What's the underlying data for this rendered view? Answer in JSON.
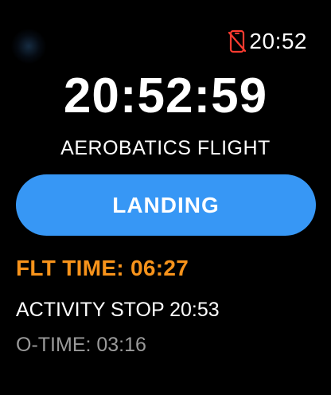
{
  "status_bar": {
    "time": "20:52",
    "disconnected_icon": "phone-disconnected-icon",
    "icon_color": "#ff3b30"
  },
  "main": {
    "clock": "20:52:59",
    "activity_name": "AEROBATICS FLIGHT",
    "landing_button_label": "LANDING",
    "flight_time": "FLT TIME: 06:27",
    "activity_stop": "ACTIVITY STOP 20:53",
    "o_time": "O-TIME: 03:16"
  },
  "colors": {
    "background": "#000000",
    "button": "#3797f5",
    "flight_time": "#f7931b",
    "secondary_text": "#9a9a9a"
  }
}
